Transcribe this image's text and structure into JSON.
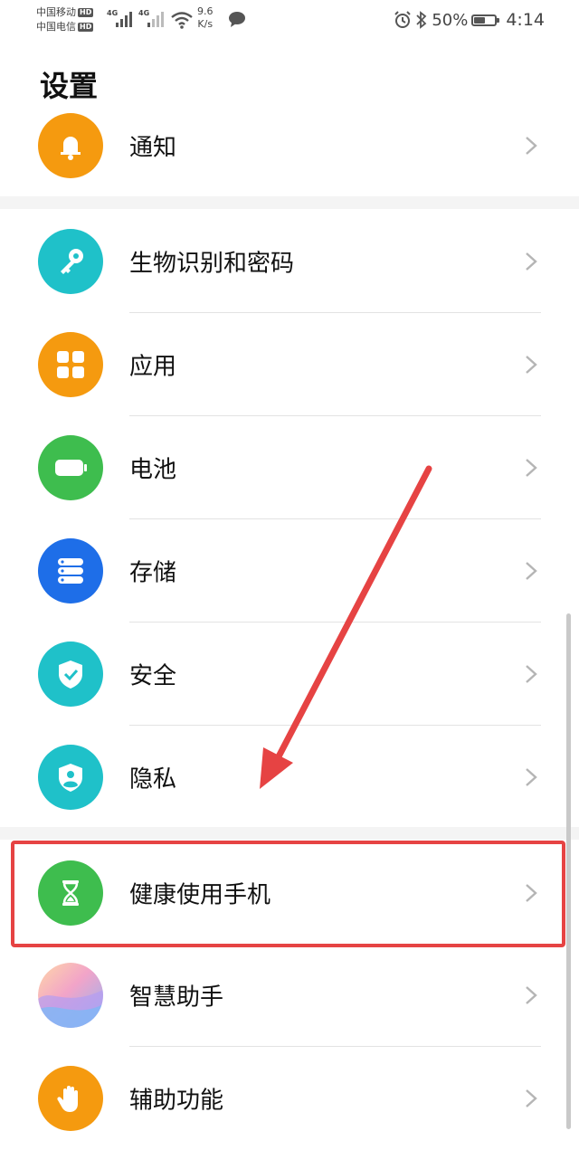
{
  "status_bar": {
    "carrier1": "中国移动",
    "carrier2": "中国电信",
    "hd_badge": "HD",
    "network1": "4G",
    "network2": "4G",
    "speed_value": "9.6",
    "speed_unit": "K/s",
    "battery_percent": "50%",
    "battery_level": 0.5,
    "time": "4:14"
  },
  "page": {
    "title": "设置"
  },
  "settings": [
    {
      "label": "通知",
      "icon": "bell-icon",
      "color": "#F59A0F"
    },
    {
      "label": "生物识别和密码",
      "icon": "key-icon",
      "color": "#1FC1C9"
    },
    {
      "label": "应用",
      "icon": "apps-grid-icon",
      "color": "#F59A0F"
    },
    {
      "label": "电池",
      "icon": "battery-icon",
      "color": "#3EBD4E"
    },
    {
      "label": "存储",
      "icon": "storage-icon",
      "color": "#1E6EE8"
    },
    {
      "label": "安全",
      "icon": "shield-check-icon",
      "color": "#1FC1C9"
    },
    {
      "label": "隐私",
      "icon": "privacy-shield-icon",
      "color": "#1FC1C9"
    },
    {
      "label": "健康使用手机",
      "icon": "hourglass-icon",
      "color": "#3EBD4E"
    },
    {
      "label": "智慧助手",
      "icon": "smart-assistant-icon",
      "color": "#B9A6F0"
    },
    {
      "label": "辅助功能",
      "icon": "hand-icon",
      "color": "#F59A0F"
    }
  ],
  "colors": {
    "annotation_red": "#E64343",
    "divider": "#E3E3E3",
    "chevron": "#B5B5B5"
  }
}
